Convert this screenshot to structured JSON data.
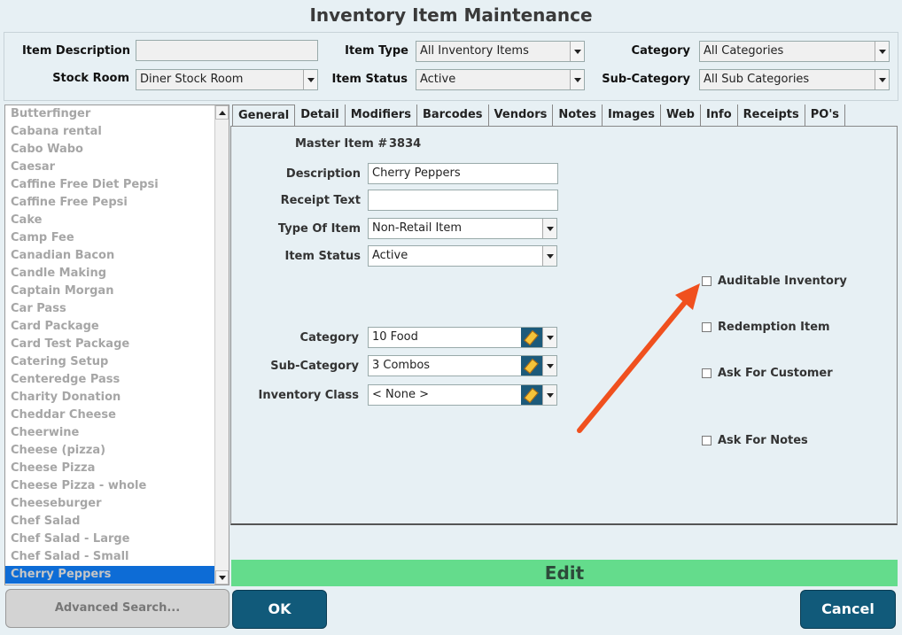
{
  "title": "Inventory Item Maintenance",
  "filters": {
    "item_description_label": "Item Description",
    "item_description_value": "",
    "item_type_label": "Item Type",
    "item_type_value": "All Inventory Items",
    "category_label": "Category",
    "category_value": "All Categories",
    "stock_room_label": "Stock Room",
    "stock_room_value": "Diner Stock Room",
    "item_status_label": "Item Status",
    "item_status_value": "Active",
    "sub_category_label": "Sub-Category",
    "sub_category_value": "All Sub Categories"
  },
  "list": {
    "items": [
      "Butterfinger",
      "Cabana rental",
      "Cabo Wabo",
      "Caesar",
      "Caffine Free Diet Pepsi",
      "Caffine Free Pepsi",
      "Cake",
      "Camp Fee",
      "Canadian Bacon",
      "Candle Making",
      "Captain Morgan",
      "Car Pass",
      "Card Package",
      "Card Test Package",
      "Catering Setup",
      "Centeredge Pass",
      "Charity Donation",
      "Cheddar Cheese",
      "Cheerwine",
      "Cheese (pizza)",
      "Cheese Pizza",
      "Cheese Pizza - whole",
      "Cheeseburger",
      "Chef Salad",
      "Chef Salad - Large",
      "Chef Salad - Small",
      "Cherry Peppers"
    ],
    "selected": "Cherry Peppers"
  },
  "tabs": [
    "General",
    "Detail",
    "Modifiers",
    "Barcodes",
    "Vendors",
    "Notes",
    "Images",
    "Web",
    "Info",
    "Receipts",
    "PO's"
  ],
  "active_tab": "General",
  "general": {
    "master_item_label": "Master Item #",
    "master_item_value": "3834",
    "description_label": "Description",
    "description_value": "Cherry Peppers",
    "receipt_text_label": "Receipt Text",
    "receipt_text_value": "",
    "type_of_item_label": "Type Of Item",
    "type_of_item_value": "Non-Retail Item",
    "item_status_label": "Item Status",
    "item_status_value": "Active",
    "category_label": "Category",
    "category_value": "10 Food",
    "sub_category_label": "Sub-Category",
    "sub_category_value": "3 Combos",
    "inventory_class_label": "Inventory Class",
    "inventory_class_value": "< None >",
    "checkboxes": {
      "auditable": "Auditable Inventory",
      "redemption": "Redemption Item",
      "ask_customer": "Ask For Customer",
      "ask_notes": "Ask For Notes"
    }
  },
  "mode_bar": "Edit",
  "buttons": {
    "advanced_search": "Advanced Search...",
    "ok": "OK",
    "cancel": "Cancel"
  },
  "colors": {
    "accent": "#115a7a",
    "edit_bar": "#64dc8c",
    "selected_row": "#0d6cd6",
    "annotation_arrow": "#f0501e"
  }
}
